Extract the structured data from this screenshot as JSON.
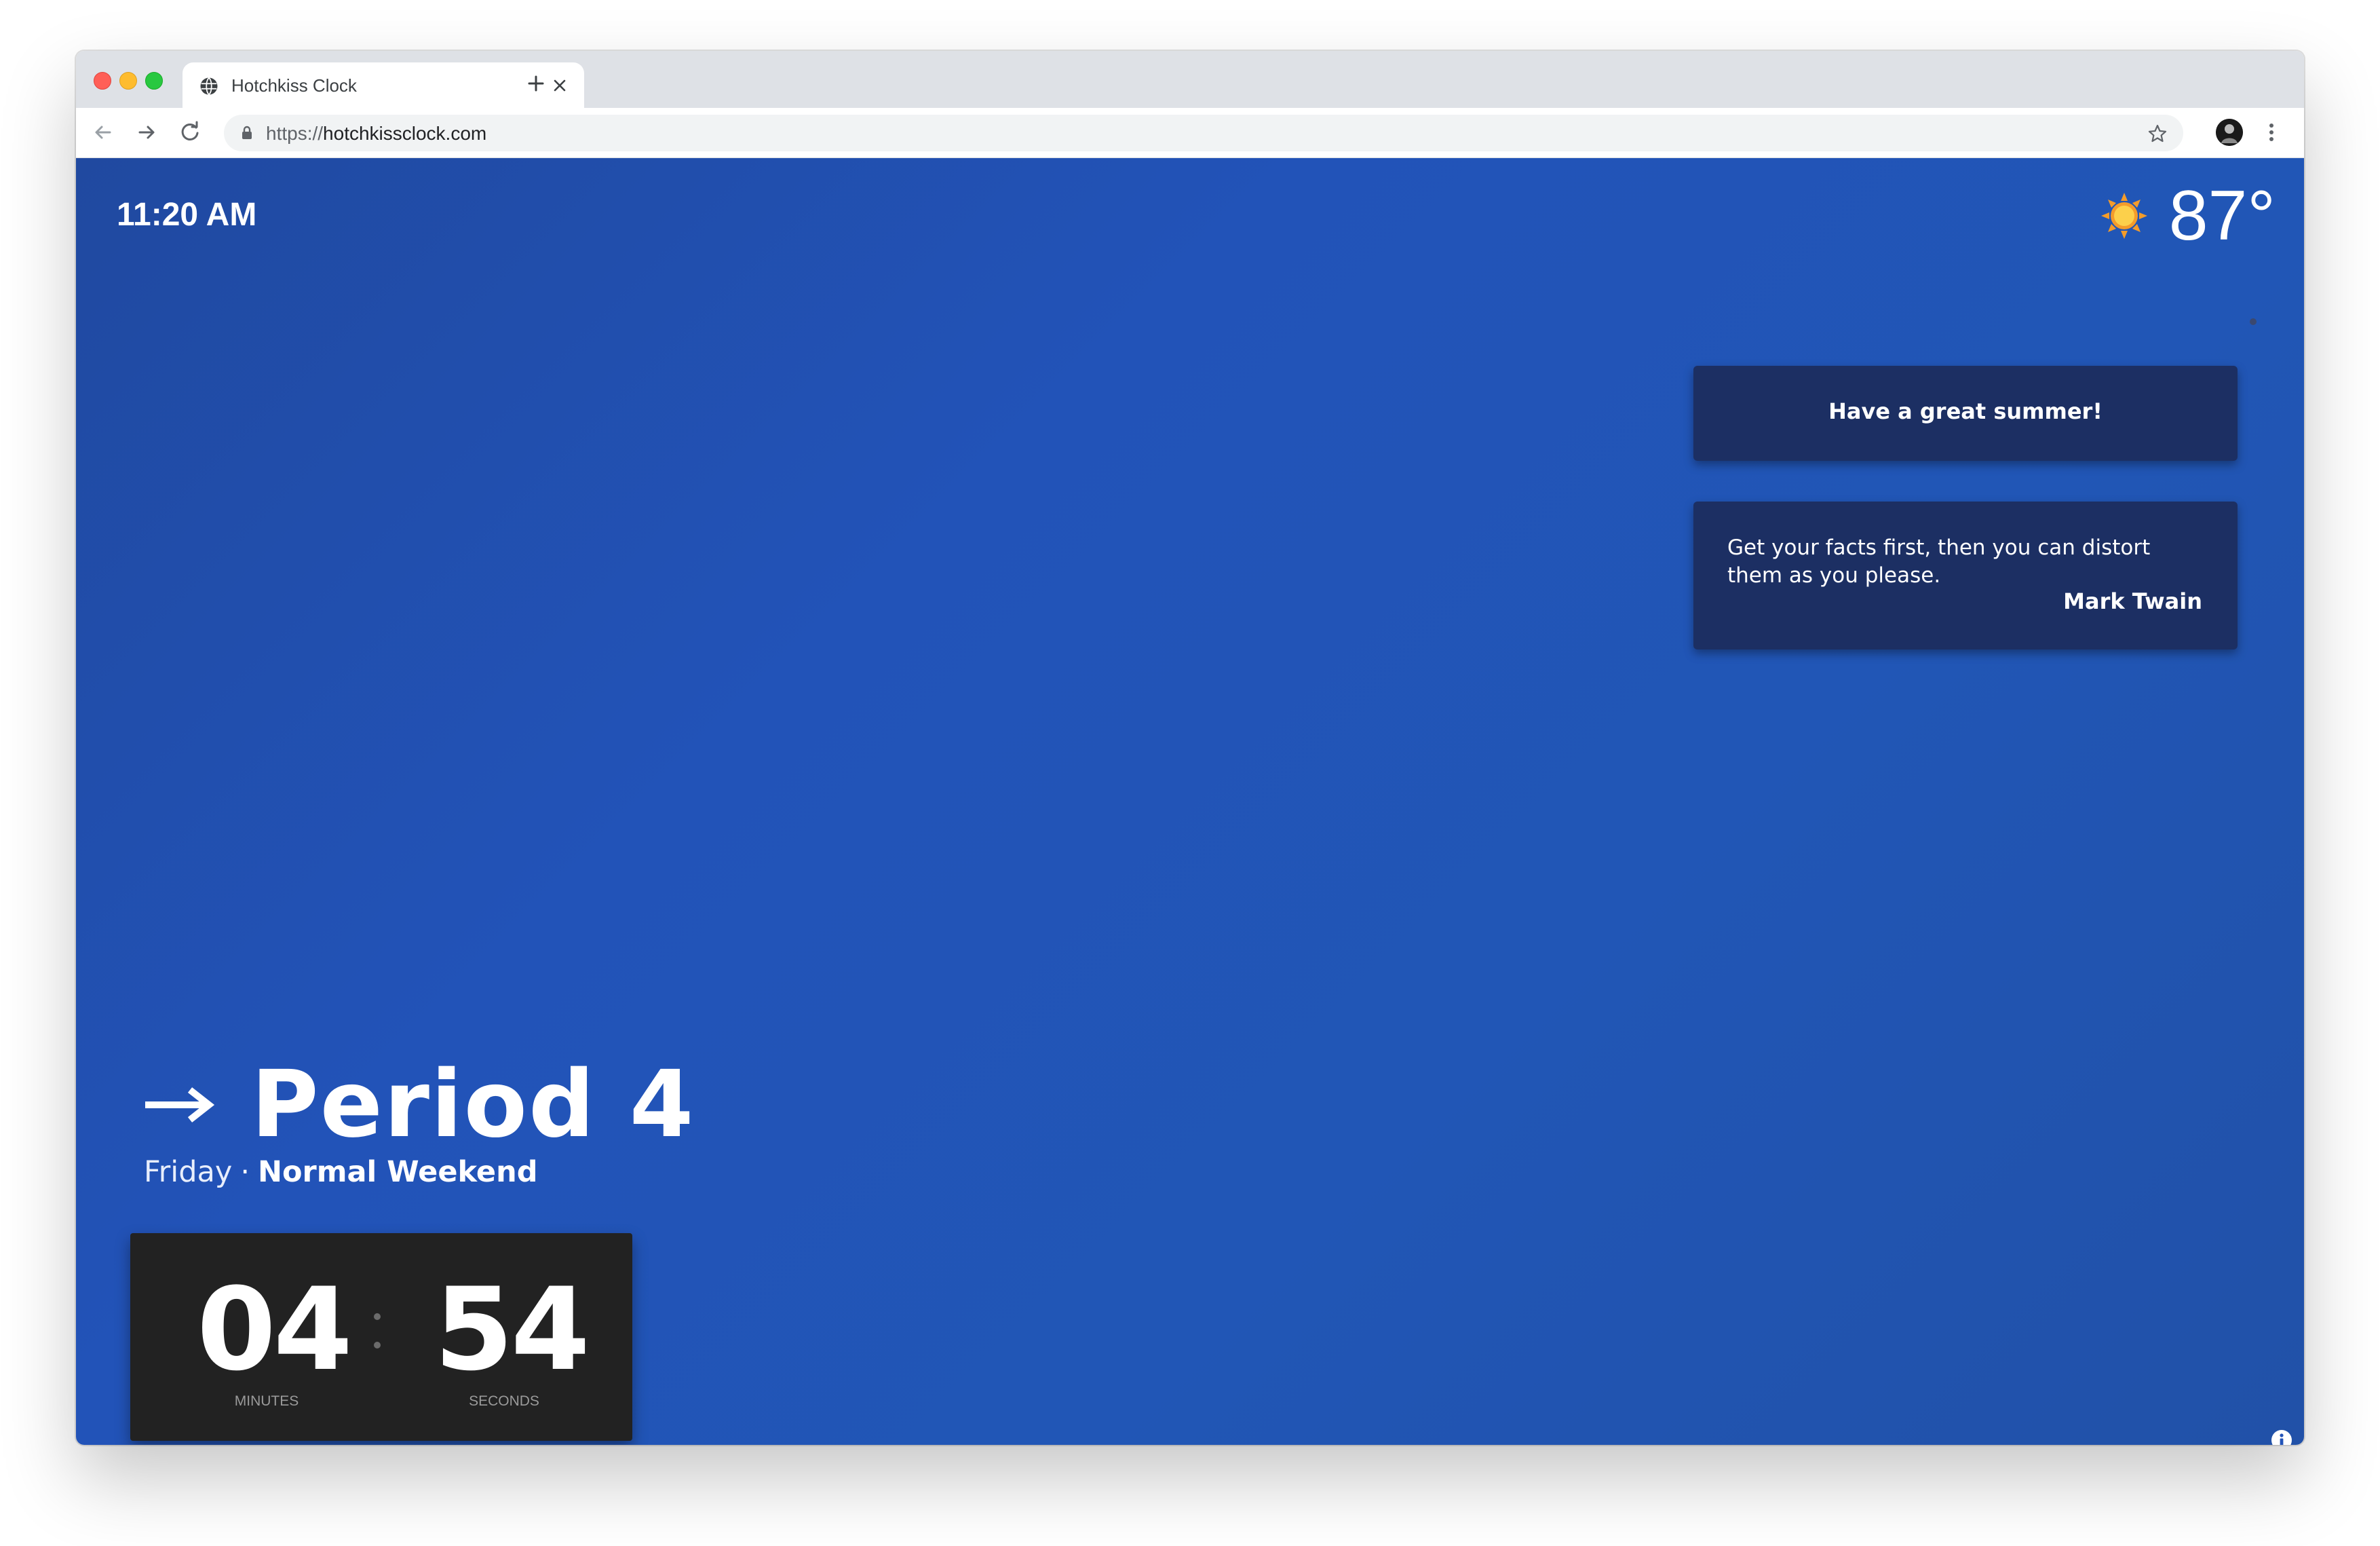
{
  "browser": {
    "tab_title": "Hotchkiss Clock",
    "url_scheme": "https://",
    "url_host": "hotchkissclock.com",
    "icons": [
      "globe-icon",
      "close-icon",
      "plus-icon",
      "back-arrow-icon",
      "forward-arrow-icon",
      "reload-icon",
      "lock-icon",
      "star-icon",
      "avatar",
      "kebab-menu-icon"
    ]
  },
  "clock": {
    "time": "11:20 AM"
  },
  "weather": {
    "icon": "sun-icon",
    "temperature": "87°"
  },
  "announcement": {
    "text": "Have a great summer!"
  },
  "quote": {
    "text": "Get your facts first, then you can distort them as you please.",
    "author": "Mark Twain"
  },
  "period": {
    "title": "Period 4",
    "day": "Friday",
    "separator": "·",
    "schedule": "Normal Weekend"
  },
  "timer": {
    "minutes": "04",
    "seconds": "54",
    "minutes_label": "MINUTES",
    "seconds_label": "SECONDS"
  },
  "footer": {
    "icons": [
      "info-icon",
      "bug-icon"
    ]
  },
  "colors": {
    "background": "#2253b8",
    "card": "#1c2f63",
    "timer_bg": "#222222",
    "sun": "#f6b73c"
  }
}
